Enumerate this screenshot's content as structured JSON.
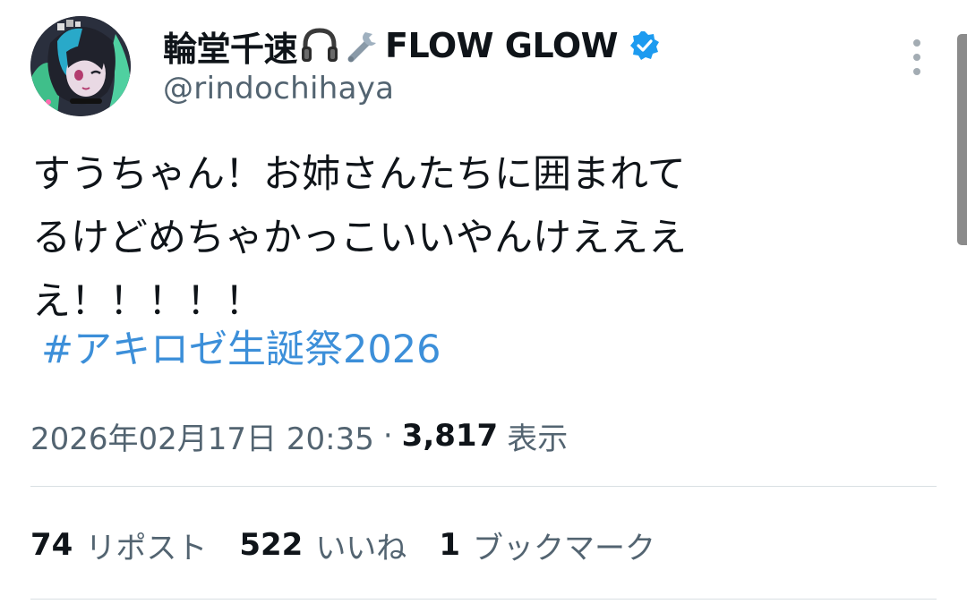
{
  "author": {
    "display_name": "輪堂千速",
    "emoji_icons": [
      "headphones-icon",
      "wrench-icon"
    ],
    "brand": "FLOW GLOW",
    "handle": "@rindochihaya",
    "verified": true
  },
  "tweet": {
    "lines": [
      "すうちゃん！お姉さんたちに囲まれて",
      "るけどめちゃかっこいいやんけえええ",
      "え！！！！！"
    ],
    "hashtag": "#アキロゼ生誕祭2026"
  },
  "meta": {
    "timestamp": "2026年02月17日 20:35",
    "separator": "·",
    "views_count": "3,817",
    "views_label": "表示"
  },
  "stats": [
    {
      "count": "74",
      "label": "リポスト"
    },
    {
      "count": "522",
      "label": "いいね"
    },
    {
      "count": "1",
      "label": "ブックマーク"
    }
  ],
  "colors": {
    "hashtag": "#3c8fd9",
    "verified_badge": "#1d9bf0",
    "secondary_text": "#536471",
    "primary_text": "#0f1419",
    "divider": "#d9dfe3"
  }
}
